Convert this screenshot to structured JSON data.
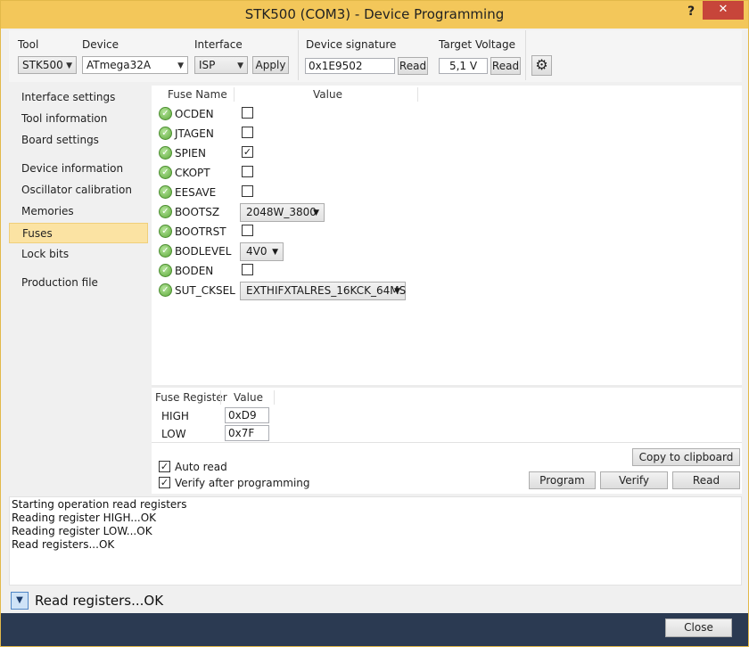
{
  "window": {
    "title": "STK500 (COM3) - Device Programming",
    "help_label": "?",
    "close_label": "✕"
  },
  "toolbar": {
    "tool_label": "Tool",
    "tool_value": "STK500",
    "device_label": "Device",
    "device_value": "ATmega32A",
    "interface_label": "Interface",
    "interface_value": "ISP",
    "apply_label": "Apply",
    "signature_label": "Device signature",
    "signature_value": "0x1E9502",
    "signature_read_label": "Read",
    "voltage_label": "Target Voltage",
    "voltage_value": "5,1 V",
    "voltage_read_label": "Read"
  },
  "sidebar": {
    "items": [
      {
        "label": "Interface settings"
      },
      {
        "label": "Tool information"
      },
      {
        "label": "Board settings"
      },
      {
        "label": "Device information"
      },
      {
        "label": "Oscillator calibration"
      },
      {
        "label": "Memories"
      },
      {
        "label": "Fuses"
      },
      {
        "label": "Lock bits"
      },
      {
        "label": "Production file"
      }
    ],
    "selected": "Fuses"
  },
  "fuses": {
    "columns": [
      "Fuse Name",
      "Value"
    ],
    "rows": [
      {
        "name": "OCDEN",
        "checked": false
      },
      {
        "name": "JTAGEN",
        "checked": false
      },
      {
        "name": "SPIEN",
        "checked": true,
        "mark": "✓"
      },
      {
        "name": "CKOPT",
        "checked": false
      },
      {
        "name": "EESAVE",
        "checked": false
      },
      {
        "name": "BOOTSZ",
        "select": "2048W_3800"
      },
      {
        "name": "BOOTRST",
        "checked": false
      },
      {
        "name": "BODLEVEL",
        "select": "4V0"
      },
      {
        "name": "BODEN",
        "checked": false
      },
      {
        "name": "SUT_CKSEL",
        "select": "EXTHIFXTALRES_16KCK_64MS"
      }
    ]
  },
  "registers": {
    "columns": [
      "Fuse Register",
      "Value"
    ],
    "rows": [
      {
        "name": "HIGH",
        "value": "0xD9"
      },
      {
        "name": "LOW",
        "value": "0x7F"
      }
    ]
  },
  "options": {
    "auto_read_label": "Auto read",
    "auto_read_checked": true,
    "verify_label": "Verify after programming",
    "verify_checked": true,
    "check_mark": "✓"
  },
  "actions": {
    "copy_label": "Copy to clipboard",
    "program_label": "Program",
    "verify_label": "Verify",
    "read_label": "Read"
  },
  "log": {
    "lines": [
      "Starting operation read registers",
      "Reading register HIGH...OK",
      "Reading register LOW...OK",
      "Read registers...OK"
    ]
  },
  "status": {
    "text": "Read registers...OK",
    "toggle_glyph": "▼"
  },
  "footer": {
    "close_label": "Close"
  },
  "icons": {
    "check": "✓",
    "combo_arrow": "▼",
    "gear": "⚙"
  }
}
